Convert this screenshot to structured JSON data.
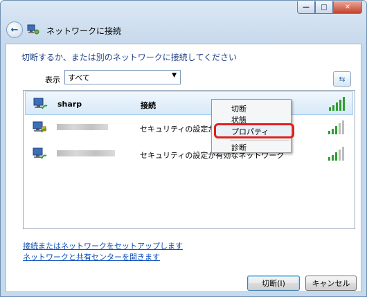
{
  "window": {
    "title": "ネットワークに接続",
    "caption_min": "—",
    "caption_max": "□",
    "caption_close": "✕"
  },
  "content": {
    "heading": "切断するか、または別のネットワークに接続してください",
    "show_label": "表示",
    "show_value": "すべて"
  },
  "networks": [
    {
      "name": "sharp",
      "status": "接続"
    },
    {
      "name": "",
      "status": "セキュリティの設定が"
    },
    {
      "name": "",
      "status": "セキュリティの設定が有効なネットワーク"
    }
  ],
  "context_menu": {
    "items": [
      "切断",
      "状態",
      "プロパティ",
      "診断"
    ]
  },
  "links": {
    "setup": "接続またはネットワークをセットアップします",
    "center": "ネットワークと共有センターを開きます"
  },
  "buttons": {
    "disconnect": "切断(I)",
    "cancel": "キャンセル"
  },
  "colors": {
    "link": "#0b4dba",
    "heading": "#1e3f86",
    "highlight": "#e0201a",
    "signal": "#2f9e2f"
  }
}
